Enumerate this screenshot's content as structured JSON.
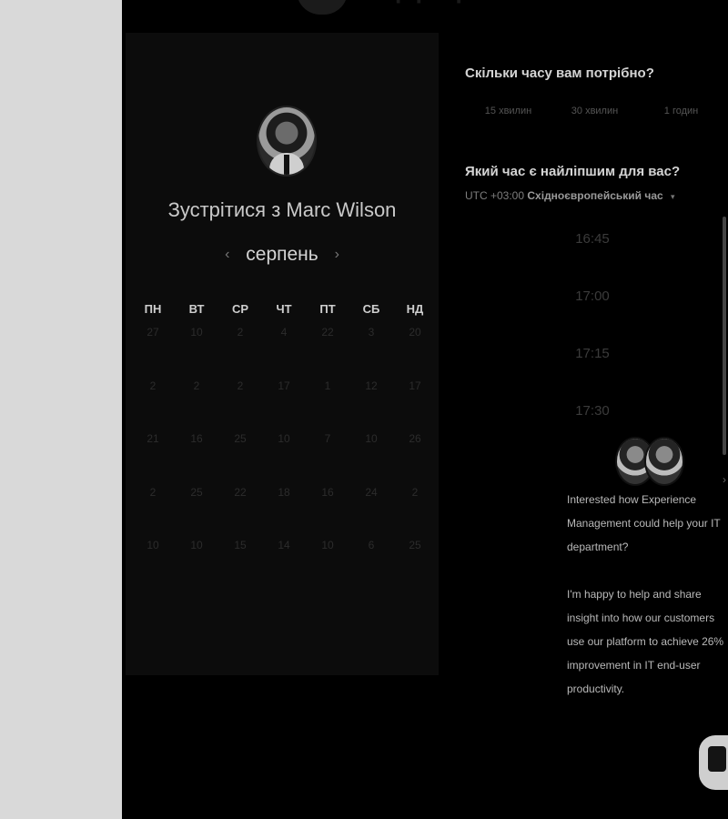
{
  "booking": {
    "title_prefix": "Зустрітися з",
    "host_name": "Marc Wilson",
    "month": "серпень",
    "prev_icon": "‹",
    "next_icon": "›",
    "weekdays": [
      "ПН",
      "ВТ",
      "СР",
      "ЧТ",
      "ПТ",
      "СБ",
      "НД"
    ],
    "days": [
      "27",
      "10",
      "2",
      "4",
      "22",
      "3",
      "20",
      "2",
      "2",
      "2",
      "17",
      "1",
      "12",
      "17",
      "21",
      "16",
      "25",
      "10",
      "7",
      "10",
      "26",
      "2",
      "25",
      "22",
      "18",
      "16",
      "24",
      "2",
      "10",
      "10",
      "15",
      "14",
      "10",
      "6",
      "25"
    ]
  },
  "duration": {
    "question": "Скільки часу вам потрібно?",
    "options": [
      "15 хвилин",
      "30 хвилин",
      "1 годин"
    ]
  },
  "time": {
    "question": "Який час є найліпшим для вас?",
    "tz_offset": "UTC +03:00",
    "tz_name": "Східноєвропейський час",
    "tz_caret": "▾",
    "slots": [
      "16:45",
      "17:00",
      "17:15",
      "17:30"
    ]
  },
  "chat": {
    "message_1": "Interested how Experience Management could help your IT department?",
    "message_2": "I'm happy to help and share insight into how our customers use our platform to achieve 26% improvement in IT end-user productivity."
  }
}
